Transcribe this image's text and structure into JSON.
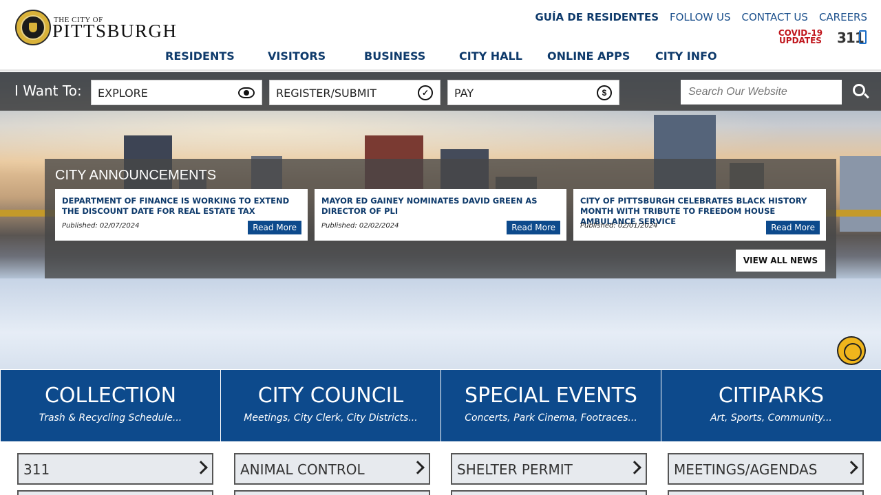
{
  "header": {
    "logo_small": "THE CITY OF",
    "logo_big": "PITTSBURGH",
    "top_links": [
      "GUÍA DE RESIDENTES",
      "FOLLOW US",
      "CONTACT US",
      "CAREERS"
    ],
    "covid_line1": "COVID-19",
    "covid_line2": "UPDATES",
    "three11": "311"
  },
  "nav": [
    "RESIDENTS",
    "VISITORS",
    "BUSINESS",
    "CITY HALL",
    "ONLINE APPS",
    "CITY INFO"
  ],
  "iwant": {
    "label": "I Want To:",
    "options": [
      "EXPLORE",
      "REGISTER/SUBMIT",
      "PAY"
    ],
    "search_placeholder": "Search Our Website"
  },
  "announcements": {
    "title": "CITY ANNOUNCEMENTS",
    "items": [
      {
        "headline": "DEPARTMENT OF FINANCE IS WORKING TO EXTEND THE DISCOUNT DATE FOR REAL ESTATE TAX",
        "published": "Published: 02/07/2024",
        "more": "Read More"
      },
      {
        "headline": "MAYOR ED GAINEY NOMINATES DAVID GREEN AS DIRECTOR OF PLI",
        "published": "Published: 02/02/2024",
        "more": "Read More"
      },
      {
        "headline": "CITY OF PITTSBURGH CELEBRATES BLACK HISTORY MONTH WITH TRIBUTE TO FREEDOM HOUSE AMBULANCE SERVICE",
        "published": "Published: 02/01/2024",
        "more": "Read More"
      }
    ],
    "view_all": "VIEW ALL NEWS"
  },
  "tiles": [
    {
      "title": "COLLECTION",
      "subtitle": "Trash & Recycling Schedule..."
    },
    {
      "title": "CITY COUNCIL",
      "subtitle": "Meetings, City Clerk, City Districts..."
    },
    {
      "title": "SPECIAL EVENTS",
      "subtitle": "Concerts, Park Cinema, Footraces..."
    },
    {
      "title": "CITIPARKS",
      "subtitle": "Art, Sports, Community..."
    }
  ],
  "quick_links": [
    "311",
    "ANIMAL CONTROL",
    "SHELTER PERMIT",
    "MEETINGS/AGENDAS"
  ],
  "colors": {
    "brand_blue": "#0d4a8c",
    "link_blue": "#1a4f8c",
    "covid_red": "#c0151c",
    "accessibility_yellow": "#f0b51c"
  }
}
